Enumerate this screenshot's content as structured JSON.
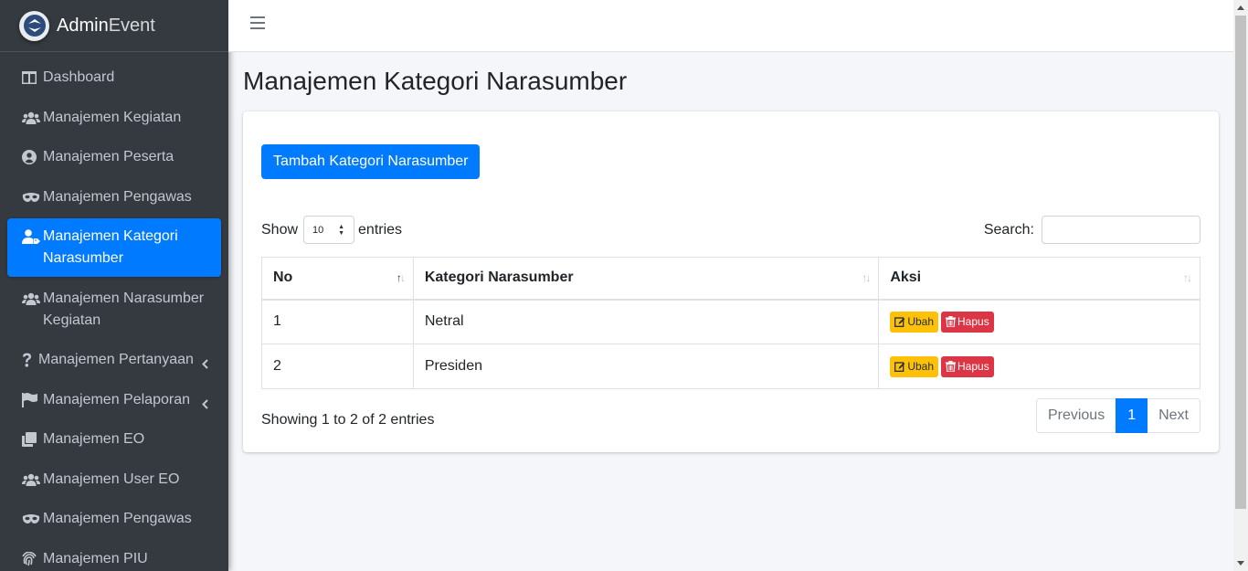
{
  "brand": {
    "name_bold": "Admin",
    "name_light": "Event"
  },
  "sidebar": {
    "items": [
      {
        "label": "Dashboard",
        "icon": "columns-icon"
      },
      {
        "label": "Manajemen Kegiatan",
        "icon": "users-icon"
      },
      {
        "label": "Manajemen Peserta",
        "icon": "user-circle-icon"
      },
      {
        "label": "Manajemen Pengawas",
        "icon": "mask-icon"
      },
      {
        "label": "Manajemen Kategori Narasumber",
        "icon": "user-tag-icon",
        "active": true
      },
      {
        "label": "Manajemen Narasumber Kegiatan",
        "icon": "users-icon"
      },
      {
        "label": "Manajemen Pertanyaan",
        "icon": "question-icon",
        "has_children": true
      },
      {
        "label": "Manajemen Pelaporan",
        "icon": "flag-icon",
        "has_children": true
      },
      {
        "label": "Manajemen EO",
        "icon": "copy-icon"
      },
      {
        "label": "Manajemen User EO",
        "icon": "users-icon"
      },
      {
        "label": "Manajemen Pengawas",
        "icon": "mask-icon"
      },
      {
        "label": "Manajemen PIU",
        "icon": "fingerprint-icon"
      }
    ]
  },
  "page": {
    "title": "Manajemen Kategori Narasumber"
  },
  "toolbar": {
    "add_label": "Tambah Kategori Narasumber"
  },
  "table_controls": {
    "show_label": "Show",
    "entries_value": "10",
    "entries_label": "entries",
    "search_label": "Search:"
  },
  "table": {
    "headers": [
      "No",
      "Kategori Narasumber",
      "Aksi"
    ],
    "rows": [
      {
        "no": "1",
        "kategori": "Netral"
      },
      {
        "no": "2",
        "kategori": "Presiden"
      }
    ],
    "edit_label": "Ubah",
    "delete_label": "Hapus"
  },
  "footer": {
    "info": "Showing 1 to 2 of 2 entries",
    "previous": "Previous",
    "page": "1",
    "next": "Next"
  },
  "colors": {
    "primary": "#007bff",
    "warning": "#ffc107",
    "danger": "#dc3545",
    "sidebar": "#343a40"
  }
}
